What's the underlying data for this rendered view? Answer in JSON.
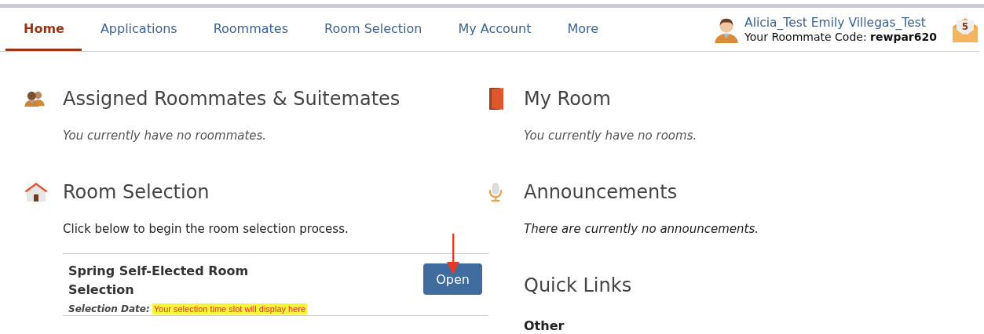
{
  "tabs": [
    {
      "label": "Home",
      "selected": true
    },
    {
      "label": "Applications",
      "selected": false
    },
    {
      "label": "Roommates",
      "selected": false
    },
    {
      "label": "Room Selection",
      "selected": false
    },
    {
      "label": "My Account",
      "selected": false
    },
    {
      "label": "More",
      "selected": false
    }
  ],
  "user": {
    "name": "Alicia_Test Emily Villegas_Test",
    "code_label": "Your Roommate Code:",
    "code": "rewpar620",
    "mail_count": "5"
  },
  "left": [
    {
      "kind": "roommates",
      "title": "Assigned Roommates & Suitemates",
      "message": "You currently have no roommates."
    },
    {
      "kind": "selection",
      "title": "Room Selection",
      "intro": "Click below to begin the room selection process.",
      "item": {
        "title": "Spring Self-Elected Room Selection",
        "date_label": "Selection Date:",
        "date_value": "Your selection time slot will display here",
        "button": "Open"
      }
    }
  ],
  "right": [
    {
      "kind": "room",
      "title": "My Room",
      "message": "You currently have no rooms."
    },
    {
      "kind": "announcements",
      "title": "Announcements",
      "message": "There are currently no announcements."
    },
    {
      "kind": "links",
      "title": "Quick Links",
      "group": "Other"
    }
  ]
}
